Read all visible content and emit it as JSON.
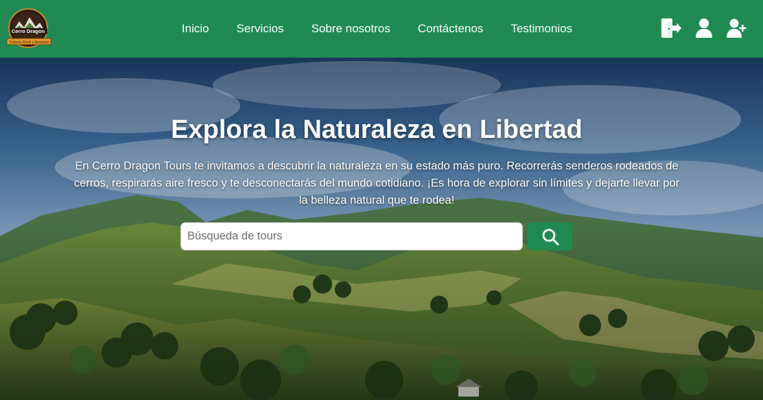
{
  "brand": {
    "logo_name": "Cerro Dragon",
    "logo_tagline": "Turismo Rural y Aventura"
  },
  "nav": {
    "items": [
      {
        "label": "Inicio"
      },
      {
        "label": "Servicios"
      },
      {
        "label": "Sobre nosotros"
      },
      {
        "label": "Contáctenos"
      },
      {
        "label": "Testimonios"
      }
    ],
    "icons": [
      "logout-icon",
      "user-icon",
      "user-plus-icon"
    ]
  },
  "hero": {
    "title": "Explora la Naturaleza en Libertad",
    "description": "En Cerro Dragon Tours te invitamos a descubrir la naturaleza en su estado más puro. Recorrerás senderos rodeados de cerros, respirarás aire fresco y te desconectarás del mundo cotidiano. ¡Es hora de explorar sin límites y dejarte llevar por la belleza natural que te rodea!",
    "search_placeholder": "Búsqueda de tours",
    "search_value": ""
  },
  "colors": {
    "primary": "#1f8b53",
    "text_light": "#ffffff"
  }
}
